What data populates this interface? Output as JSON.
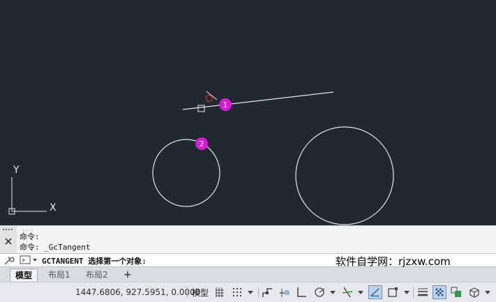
{
  "canvas": {
    "markers": [
      {
        "label": "1"
      },
      {
        "label": "2"
      }
    ],
    "ucs": {
      "x_label": "X",
      "y_label": "Y"
    }
  },
  "command": {
    "history": [
      "命令:",
      "命令: _GcTangent"
    ],
    "prompt": "GCTANGENT 选择第一个对象:"
  },
  "watermark": "软件自学网：rjzxw.com",
  "tabs": [
    {
      "label": "模型",
      "active": true
    },
    {
      "label": "布局1",
      "active": false
    },
    {
      "label": "布局2",
      "active": false
    }
  ],
  "add_tab": "+",
  "status": {
    "coordinates": "1447.6806, 927.5951, 0.0000",
    "model_label": "模型"
  },
  "colors": {
    "canvas_bg": "#212830",
    "marker": "#d61ad6",
    "geometry": "#e6e6e6",
    "cursor_red": "#e03030"
  }
}
